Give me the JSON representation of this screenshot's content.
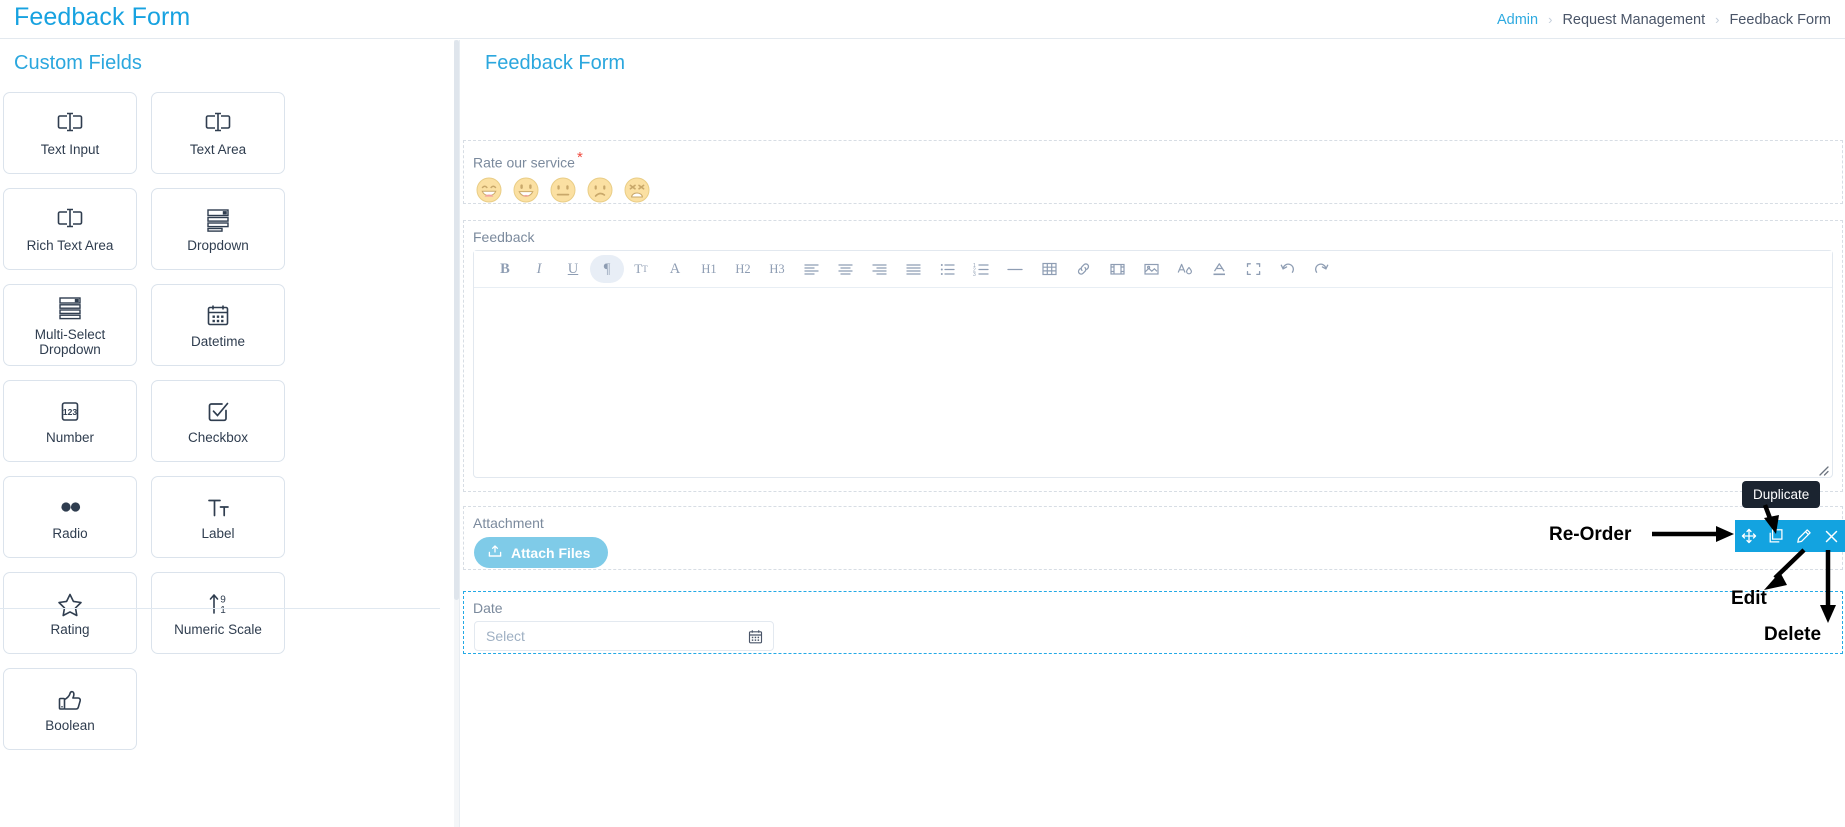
{
  "app": {
    "title": "Feedback Form"
  },
  "breadcrumb": {
    "items": [
      "Admin",
      "Request Management",
      "Feedback Form"
    ],
    "separator": "›"
  },
  "sidebar": {
    "title": "Custom Fields",
    "items": [
      {
        "label": "Text Input",
        "icon": "text-input-icon"
      },
      {
        "label": "Text Area",
        "icon": "text-area-icon"
      },
      {
        "label": "Rich Text Area",
        "icon": "rich-text-area-icon"
      },
      {
        "label": "Dropdown",
        "icon": "dropdown-icon"
      },
      {
        "label": "Multi-Select Dropdown",
        "icon": "multi-select-dropdown-icon"
      },
      {
        "label": "Datetime",
        "icon": "datetime-icon"
      },
      {
        "label": "Number",
        "icon": "number-icon"
      },
      {
        "label": "Checkbox",
        "icon": "checkbox-icon"
      },
      {
        "label": "Radio",
        "icon": "radio-icon"
      },
      {
        "label": "Label",
        "icon": "label-icon"
      },
      {
        "label": "Rating",
        "icon": "rating-star-icon"
      },
      {
        "label": "Numeric Scale",
        "icon": "numeric-scale-icon"
      },
      {
        "label": "Boolean",
        "icon": "boolean-thumbs-up-icon"
      }
    ]
  },
  "form": {
    "title": "Feedback Form",
    "rating_field": {
      "label": "Rate our service",
      "required_marker": "*",
      "options": [
        {
          "name": "emoji-very-happy"
        },
        {
          "name": "emoji-happy"
        },
        {
          "name": "emoji-neutral"
        },
        {
          "name": "emoji-sad"
        },
        {
          "name": "emoji-very-sad"
        }
      ]
    },
    "feedback_field": {
      "label": "Feedback",
      "value": "",
      "toolbar": [
        {
          "name": "bold-icon",
          "glyph": "B"
        },
        {
          "name": "italic-icon",
          "glyph": "I"
        },
        {
          "name": "underline-icon",
          "glyph": "U"
        },
        {
          "name": "paragraph-icon",
          "glyph": "¶"
        },
        {
          "name": "font-size-icon",
          "glyph": "Tт"
        },
        {
          "name": "font-family-icon",
          "glyph": "A"
        },
        {
          "name": "heading-1-icon",
          "glyph": "H1"
        },
        {
          "name": "heading-2-icon",
          "glyph": "H2"
        },
        {
          "name": "heading-3-icon",
          "glyph": "H3"
        },
        {
          "name": "align-left-icon",
          "glyph": ""
        },
        {
          "name": "align-center-icon",
          "glyph": ""
        },
        {
          "name": "align-right-icon",
          "glyph": ""
        },
        {
          "name": "align-justify-icon",
          "glyph": ""
        },
        {
          "name": "bullet-list-icon",
          "glyph": ""
        },
        {
          "name": "numbered-list-icon",
          "glyph": ""
        },
        {
          "name": "horizontal-rule-icon",
          "glyph": ""
        },
        {
          "name": "table-icon",
          "glyph": ""
        },
        {
          "name": "link-icon",
          "glyph": ""
        },
        {
          "name": "video-icon",
          "glyph": ""
        },
        {
          "name": "image-icon",
          "glyph": ""
        },
        {
          "name": "text-color-icon",
          "glyph": ""
        },
        {
          "name": "highlight-color-icon",
          "glyph": ""
        },
        {
          "name": "fullscreen-icon",
          "glyph": ""
        },
        {
          "name": "undo-icon",
          "glyph": ""
        },
        {
          "name": "redo-icon",
          "glyph": ""
        }
      ],
      "active_toolbar_index": 3
    },
    "attachment_field": {
      "label": "Attachment",
      "button_label": "Attach Files",
      "button_icon": "upload-icon"
    },
    "date_field": {
      "label": "Date",
      "placeholder": "Select",
      "value": "",
      "icon": "calendar-icon",
      "selected": true
    }
  },
  "action_toolbar": {
    "tooltip": "Duplicate",
    "buttons": [
      {
        "name": "reorder-button",
        "icon": "move-arrows-icon"
      },
      {
        "name": "duplicate-button",
        "icon": "copy-icon"
      },
      {
        "name": "edit-button",
        "icon": "pencil-icon"
      },
      {
        "name": "delete-button",
        "icon": "close-x-icon"
      }
    ]
  },
  "annotations": [
    {
      "text": "Re-Order"
    },
    {
      "text": "Edit"
    },
    {
      "text": "Delete"
    }
  ],
  "colors": {
    "accent": "#2ba7de",
    "toolbar_blue": "#13a3e0",
    "attach_button": "#7fcbe8",
    "required_red": "#f04a3e",
    "tooltip_bg": "#1b2430"
  }
}
